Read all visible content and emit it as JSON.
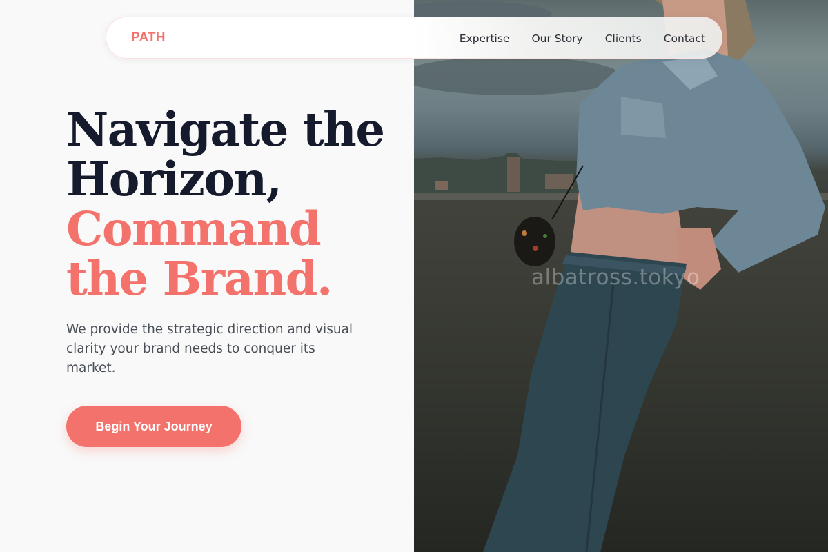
{
  "brand": {
    "name": "PATH",
    "accent_color": "#f3726b",
    "dark_color": "#151a2d"
  },
  "nav": {
    "links": [
      "Expertise",
      "Our Story",
      "Clients",
      "Contact"
    ]
  },
  "hero": {
    "headline_dark_1": "Navigate the",
    "headline_dark_2": "Horizon,",
    "headline_accent_1": "Command",
    "headline_accent_2": "the Brand.",
    "subtext": "We provide the strategic direction and visual clarity your brand needs to conquer its market.",
    "cta_label": "Begin Your Journey"
  },
  "image": {
    "watermark": "albatross.tokyo"
  }
}
